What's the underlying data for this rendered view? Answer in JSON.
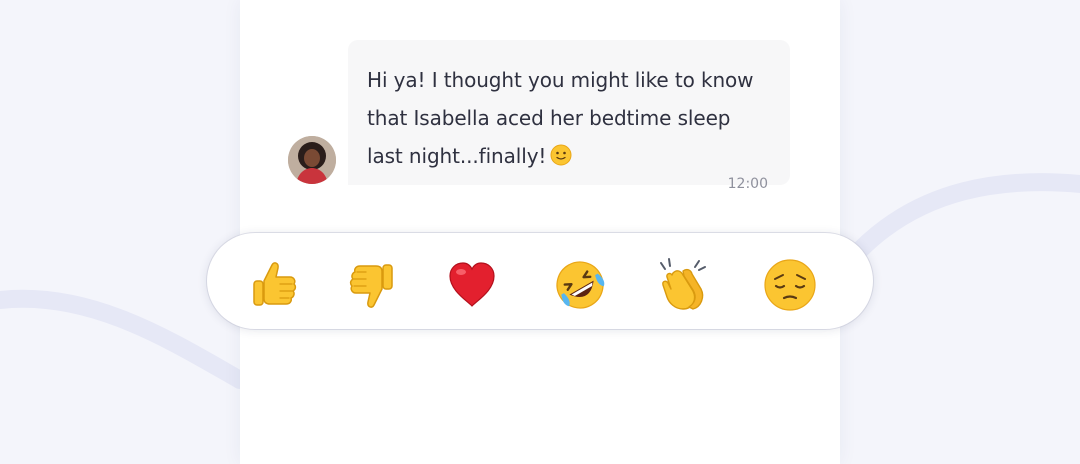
{
  "message": {
    "lines": [
      "Hi ya! I thought you might like to know",
      "that Isabella aced her bedtime sleep",
      "last night...finally!"
    ],
    "timestamp": "12:00",
    "inline_emoji": "slightly-smiling-face-icon"
  },
  "sender": {
    "avatar": "person-avatar"
  },
  "reactions": [
    {
      "name": "thumbs-up-icon"
    },
    {
      "name": "thumbs-down-icon"
    },
    {
      "name": "red-heart-icon"
    },
    {
      "name": "rolling-on-floor-laughing-icon"
    },
    {
      "name": "clapping-hands-icon"
    },
    {
      "name": "pensive-face-icon"
    }
  ],
  "colors": {
    "page_background": "#f4f5fb",
    "bubble": "#f7f7f8",
    "text": "#2f3140",
    "timestamp": "#8f919d",
    "emoji_yellow": "#fbc531",
    "heart_red": "#e3202e"
  }
}
